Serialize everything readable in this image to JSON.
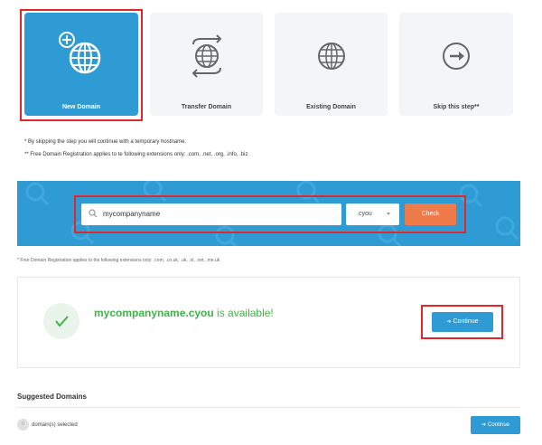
{
  "options": {
    "new_domain": "New Domain",
    "transfer_domain": "Transfer Domain",
    "existing_domain": "Existing Domain",
    "skip": "Skip this step**"
  },
  "notes": {
    "skip_note": "* By skipping the step you will continue with a temporary hostname.",
    "free_note": "** Free Domain Registration applies to te following extensions only: .com, .net, .org, .info, .biz"
  },
  "search": {
    "value": "mycompanyname",
    "tld": ".cyou",
    "check_label": "Check"
  },
  "footnote": "* Free Domain Registration applies to the following extensions only: .com, .co.uk, .uk, .nl, .net, .me.uk",
  "availability": {
    "domain": "mycompanyname.cyou",
    "suffix": " is available!",
    "continue_label": "Continue"
  },
  "suggested": {
    "title": "Suggested Domains",
    "count": "0",
    "selected_text": "domain(s) selected",
    "continue_label": "Continue"
  },
  "colors": {
    "accent_blue": "#2f9bd5",
    "check_orange": "#f07b4a",
    "success_green": "#3db545",
    "highlight_red": "#e3262a"
  }
}
